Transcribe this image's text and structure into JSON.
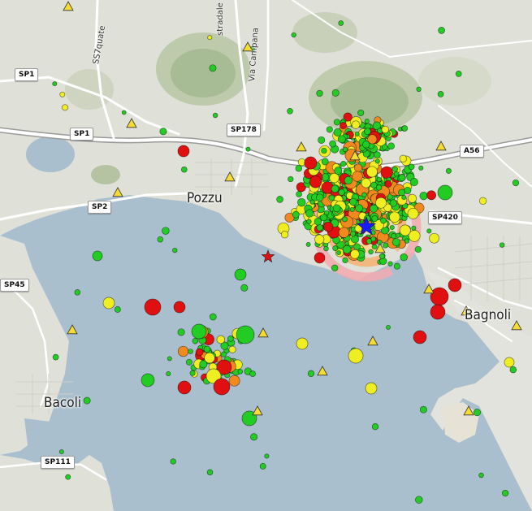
{
  "map": {
    "colors": {
      "sea": "#a9bfce",
      "land": "#dfe0d8",
      "crater": "#a7bb94",
      "magnitude_small": "#22cc22",
      "magnitude_medium": "#eeee22",
      "magnitude_large": "#f08a1e",
      "magnitude_max": "#e01010",
      "station": "#f6dc32",
      "epicenter_star": "#1a1aff",
      "ring_outer": "#f5a9b0",
      "ring_middle": "#f5b070",
      "ring_inner": "#ffd28a",
      "ring_core": "#cfe9c6"
    },
    "place_labels": {
      "pozzuoli": "Pozzu",
      "bacoli": "Bacoli",
      "bagnoli": "Bagnoli"
    },
    "street_labels": {
      "ss7_quater": "SS7quate",
      "stradale": "stradale",
      "via_campana": "Via Campana"
    },
    "road_shields": {
      "sp1_top": "SP1",
      "sp1_mid": "SP1",
      "sp178": "SP178",
      "a56": "A56",
      "sp2": "SP2",
      "sp420": "SP420",
      "sp45": "SP45",
      "sp111": "SP111"
    },
    "icons": {
      "station_marker": "yellow-triangle-icon",
      "epicenter": "blue-star-icon",
      "red_event": "red-star-icon",
      "alert_zone": "concentric-ring-icon"
    }
  }
}
